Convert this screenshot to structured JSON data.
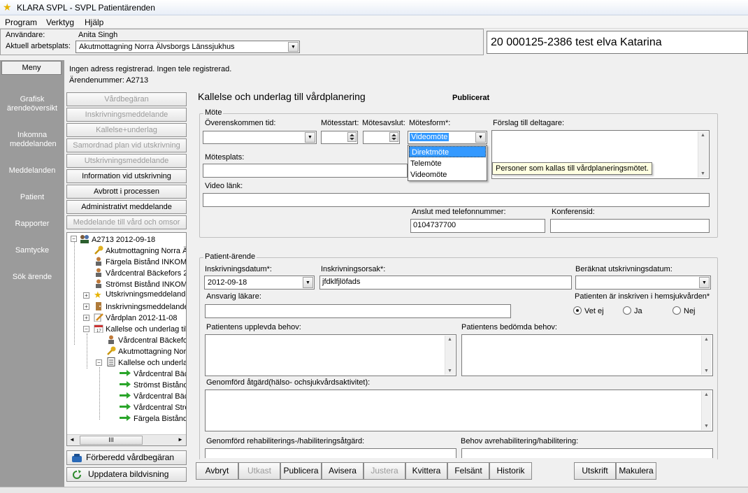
{
  "window": {
    "title": "KLARA SVPL - SVPL Patientärenden"
  },
  "menu": [
    "Program",
    "Verktyg",
    "Hjälp"
  ],
  "user": {
    "user_label": "Användare:",
    "user_name": "Anita Singh",
    "workplace_label": "Aktuell arbetsplats:",
    "workplace_value": "Akutmottagning Norra Älvsborgs Länssjukhus"
  },
  "patient": {
    "id_name": "20 000125-2386 test elva Katarina"
  },
  "info": {
    "line1": "Ingen adress registrerad.  Ingen tele registrerad.",
    "line2": "Ärendenummer: A2713"
  },
  "nav": {
    "menu_tab": "Meny",
    "items": [
      "Grafisk ärendeöversikt",
      "Inkomna meddelanden",
      "Meddelanden",
      "Patient",
      "Rapporter",
      "Samtycke",
      "Sök ärende"
    ]
  },
  "tasks": [
    {
      "label": "Vårdbegäran",
      "enabled": false
    },
    {
      "label": "Inskrivningsmeddelande",
      "enabled": false
    },
    {
      "label": "Kallelse+underlag",
      "enabled": false
    },
    {
      "label": "Samordnad plan vid utskrivning",
      "enabled": false
    },
    {
      "label": "Utskrivningsmeddelande",
      "enabled": false
    },
    {
      "label": "Information vid utskrivning",
      "enabled": true
    },
    {
      "label": "Avbrott i processen",
      "enabled": true
    },
    {
      "label": "Administrativt meddelande",
      "enabled": true
    },
    {
      "label": "Meddelande till vård och omsor",
      "enabled": false
    }
  ],
  "tree": [
    {
      "label": "A2713 2012-09-18",
      "icon": "people-icon"
    },
    {
      "label": "Akutmottagning Norra Äl",
      "icon": "key-icon"
    },
    {
      "label": "Färgela Bistånd INKOM",
      "icon": "person-icon"
    },
    {
      "label": "Vårdcentral Bäckefors 2",
      "icon": "person-icon"
    },
    {
      "label": "Strömst Bistånd INKOM",
      "icon": "person-icon"
    },
    {
      "label": "Utskrivningsmeddelande",
      "icon": "star-icon"
    },
    {
      "label": "Inskrivningsmeddelande",
      "icon": "door-icon"
    },
    {
      "label": "Vårdplan 2012-11-08",
      "icon": "pencil-icon"
    },
    {
      "label": "Kallelse och underlag till",
      "icon": "calendar-icon"
    },
    {
      "label": "Vårdcentral Bäckefo",
      "icon": "person-icon"
    },
    {
      "label": "Akutmottagning Nor",
      "icon": "key-icon"
    },
    {
      "label": "Kallelse och underla",
      "icon": "document-icon"
    },
    {
      "label": "Vårdcentral Bäc",
      "icon": "arrow-icon"
    },
    {
      "label": "Strömst Bistånd",
      "icon": "arrow-icon"
    },
    {
      "label": "Vårdcentral Bäc",
      "icon": "arrow-icon"
    },
    {
      "label": "Vårdcentral Strö",
      "icon": "arrow-icon"
    },
    {
      "label": "Färgela Bistånd",
      "icon": "arrow-icon"
    }
  ],
  "tree_scroll": {
    "thumb": "III"
  },
  "bottom_buttons": [
    "Förberedd vårdbegäran",
    "Uppdatera bildvisning"
  ],
  "form": {
    "title": "Kallelse och underlag till vårdplanering",
    "status": "Publicerat",
    "mote": {
      "legend": "Möte",
      "agreed_time_label": "Överenskommen tid:",
      "start_label": "Mötesstart:",
      "end_label": "Mötesavslut:",
      "form_label": "Mötesform*:",
      "form_value": "Videomöte",
      "form_options": [
        "Direktmöte",
        "Telemöte",
        "Videomöte"
      ],
      "form_selected_option": "Direktmöte",
      "participants_label": "Förslag till deltagare:",
      "participants_tooltip": "Personer som kallas till vårdplaneringsmötet.",
      "place_label": "Mötesplats:",
      "video_label": "Video länk:",
      "phone_label": "Anslut med telefonnummer:",
      "phone_value": "0104737700",
      "conference_label": "Konferensid:"
    },
    "patient_arende": {
      "legend": "Patient-ärende",
      "admission_date_label": "Inskrivningsdatum*:",
      "admission_date_value": "2012-09-18",
      "admission_reason_label": "Inskrivningsorsak*:",
      "admission_reason_value": "jfdklfjlöfads",
      "discharge_label": "Beräknat utskrivningsdatum:",
      "doctor_label": "Ansvarig läkare:",
      "homecare_label": "Patienten är inskriven i hemsjukvården*",
      "homecare_options": [
        "Vet ej",
        "Ja",
        "Nej"
      ],
      "homecare_selected": "Vet ej",
      "experienced_needs_label": "Patientens upplevda behov:",
      "assessed_needs_label": "Patientens bedömda behov:",
      "performed_label": "Genomförd åtgärd(hälso- ochsjukvårdsaktivitet):",
      "rehab_done_label": "Genomförd rehabiliterings-/habiliteringsåtgärd:",
      "rehab_need_label": "Behov avrehabilitering/habilitering:"
    }
  },
  "actions": [
    {
      "label": "Avbryt",
      "enabled": true
    },
    {
      "label": "Utkast",
      "enabled": false
    },
    {
      "label": "Publicera",
      "enabled": true
    },
    {
      "label": "Avisera",
      "enabled": true
    },
    {
      "label": "Justera",
      "enabled": false
    },
    {
      "label": "Kvittera",
      "enabled": true
    },
    {
      "label": "Felsänt",
      "enabled": true
    },
    {
      "label": "Historik",
      "enabled": true
    },
    {
      "label": "Utskrift",
      "enabled": true
    },
    {
      "label": "Makulera",
      "enabled": true
    }
  ],
  "colors": {
    "nav_bg": "#9b9b9b",
    "selection": "#3399ff",
    "arrow_green": "#2aa52a"
  }
}
